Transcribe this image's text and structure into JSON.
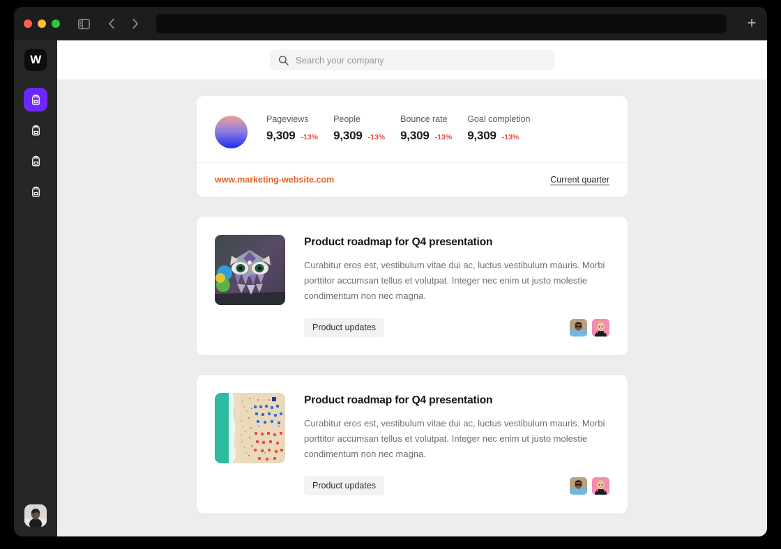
{
  "window": {
    "traffic_lights": [
      "close",
      "minimize",
      "maximize"
    ],
    "sidebar_toggle_icon": "sidebar-toggle-icon",
    "back_icon": "chevron-left-icon",
    "forward_icon": "chevron-right-icon",
    "url_value": "",
    "url_placeholder": "",
    "new_tab_label": "+"
  },
  "rail": {
    "logo_label": "W",
    "items": [
      {
        "name": "backpack-1",
        "icon": "backpack-icon",
        "active": true
      },
      {
        "name": "backpack-2",
        "icon": "backpack-icon",
        "active": false
      },
      {
        "name": "backpack-3",
        "icon": "backpack-icon",
        "active": false
      },
      {
        "name": "backpack-4",
        "icon": "backpack-icon",
        "active": false
      }
    ],
    "user_avatar": "user-portrait-avatar"
  },
  "search": {
    "icon": "search-icon",
    "value": "",
    "placeholder": "Search your company"
  },
  "stats_card": {
    "avatar": "gradient-circle-avatar",
    "metrics": [
      {
        "label": "Pageviews",
        "value": "9,309",
        "delta": "-13%"
      },
      {
        "label": "People",
        "value": "9,309",
        "delta": "-13%"
      },
      {
        "label": "Bounce rate",
        "value": "9,309",
        "delta": "-13%"
      },
      {
        "label": "Goal completion",
        "value": "9,309",
        "delta": "-13%"
      }
    ],
    "site_url": "www.marketing-website.com",
    "period": "Current quarter",
    "delta_color": "#e8443c",
    "link_color": "#e8622a"
  },
  "posts": [
    {
      "thumbnail": "owl-street-art-thumbnail",
      "title": "Product roadmap for Q4 presentation",
      "body": "Curabitur eros est, vestibulum vitae dui ac, luctus vestibulum mauris. Morbi porttitor accumsan tellus et volutpat. Integer nec enim ut justo molestie condimentum non nec magna.",
      "tag": "Product updates",
      "avatars": [
        "avatar-man-sunglasses",
        "avatar-blonde-woman"
      ]
    },
    {
      "thumbnail": "aerial-beach-thumbnail",
      "title": "Product roadmap for Q4 presentation",
      "body": "Curabitur eros est, vestibulum vitae dui ac, luctus vestibulum mauris. Morbi porttitor accumsan tellus et volutpat. Integer nec enim ut justo molestie condimentum non nec magna.",
      "tag": "Product updates",
      "avatars": [
        "avatar-man-sunglasses",
        "avatar-blonde-woman"
      ]
    }
  ],
  "colors": {
    "accent": "#6d28ff",
    "page_bg": "#ededed",
    "rail_bg": "#262626",
    "chrome_bg": "#1d1d1d"
  }
}
